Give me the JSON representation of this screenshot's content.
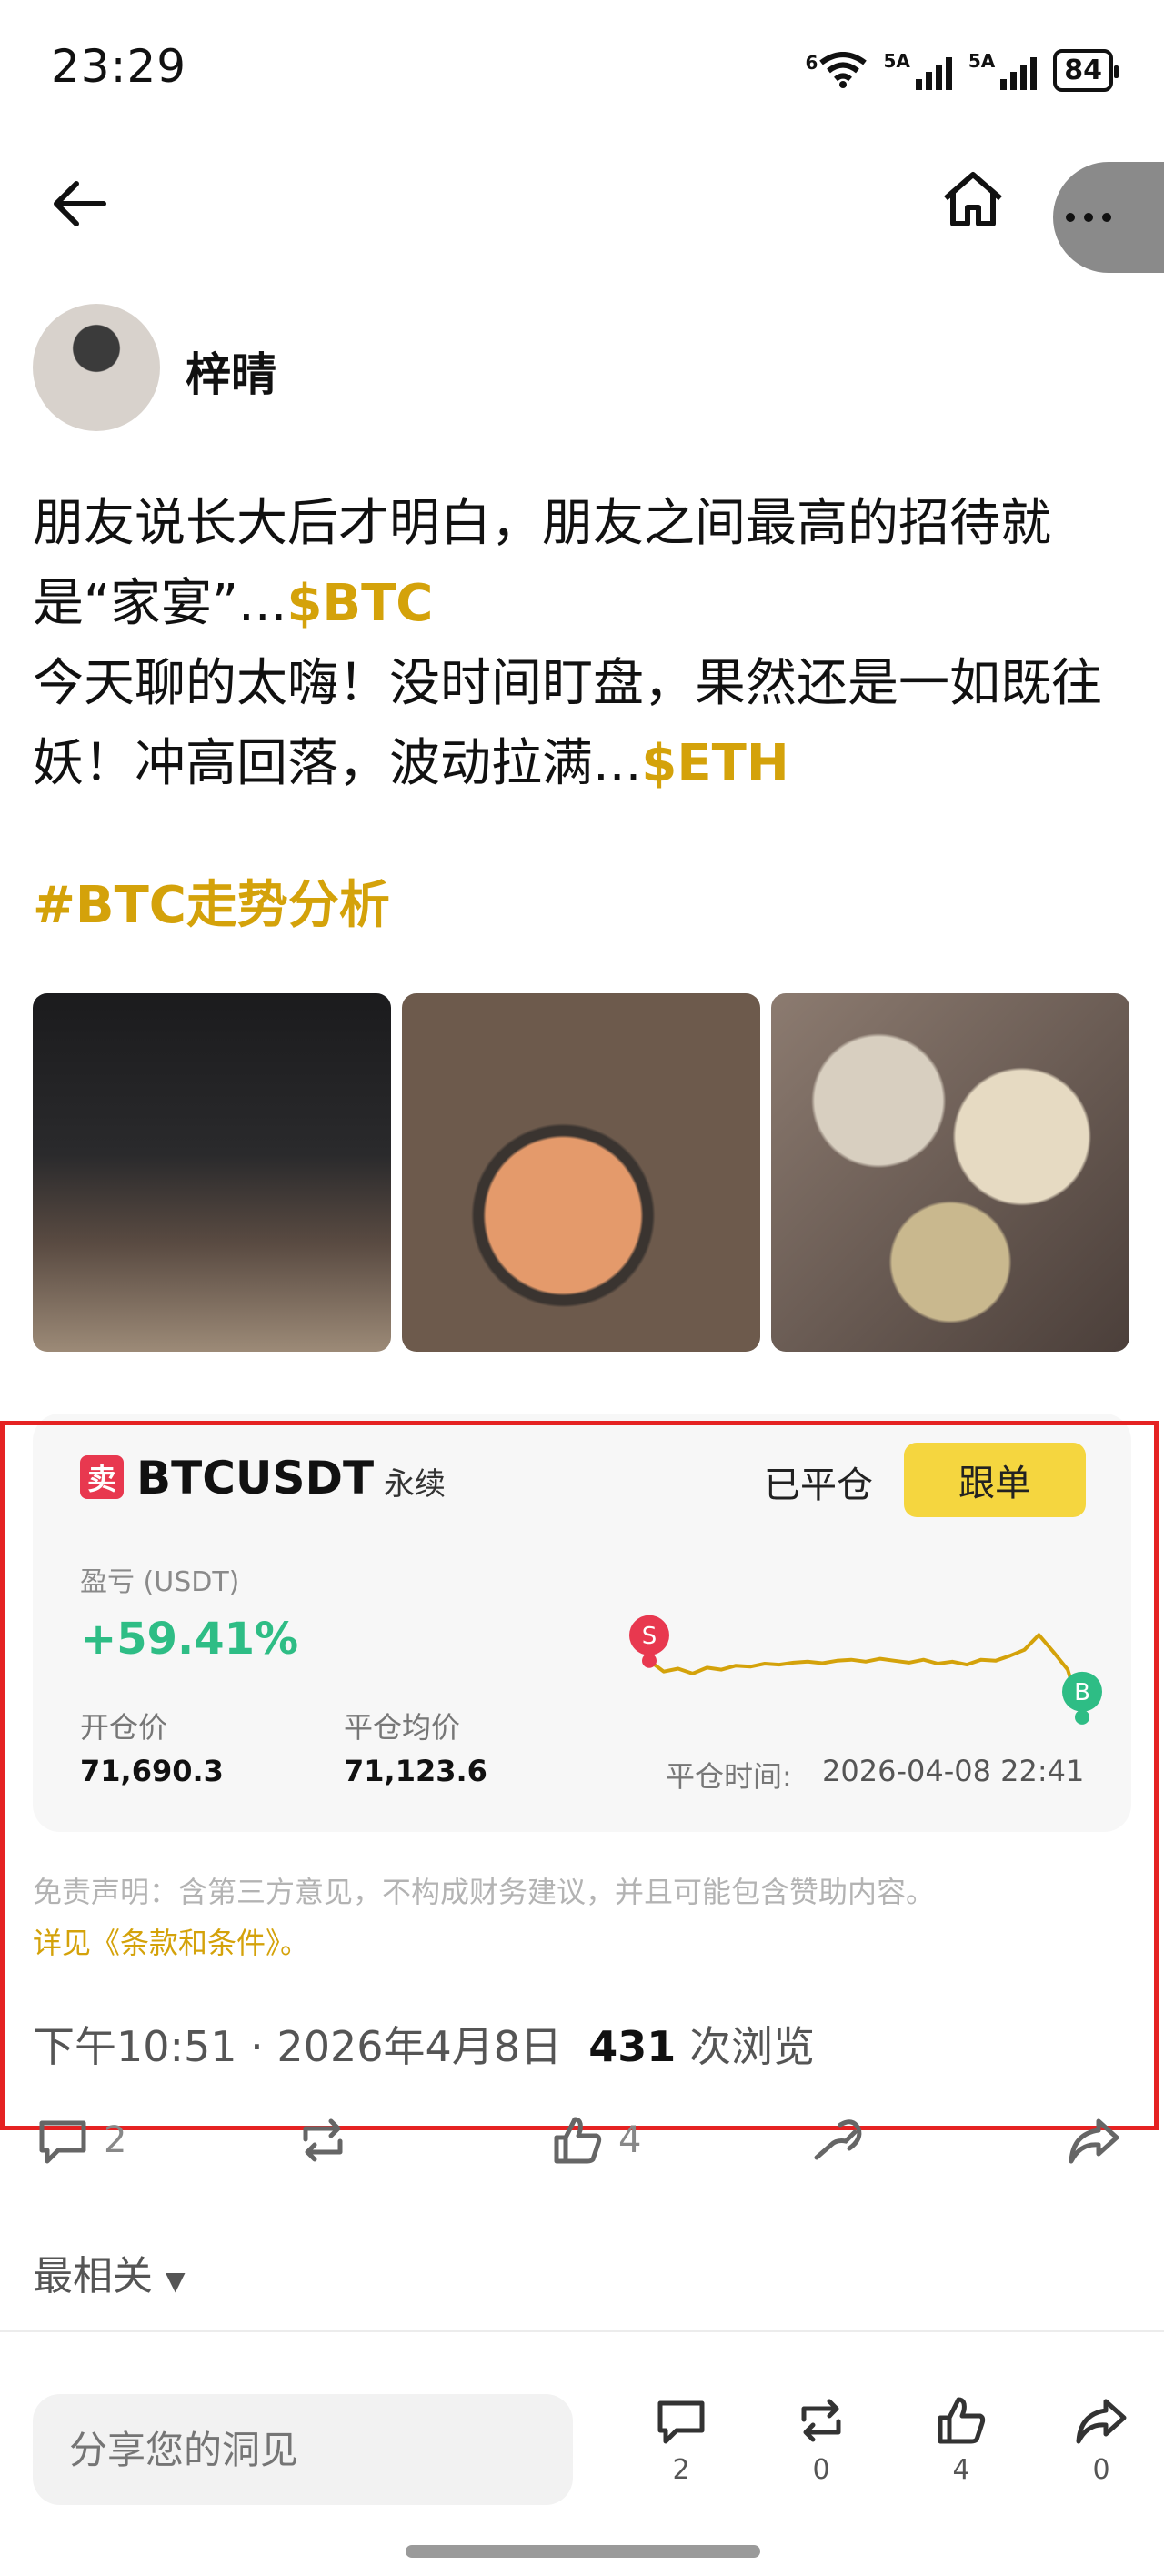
{
  "status_bar": {
    "time": "23:29",
    "wifi_label": "6",
    "sim1_label": "5A",
    "sim2_label": "5A",
    "battery": "84"
  },
  "nav": {
    "back_icon": "arrow-left-icon",
    "home_icon": "home-icon",
    "more_icon": "more-dots-icon"
  },
  "author": {
    "name": "梓晴"
  },
  "post": {
    "line1": "朋友说长大后才明白，朋友之间最高的招待就是“家宴”...",
    "ticker1": "$BTC",
    "line2": "今天聊的太嗨！没时间盯盘，果然还是一如既往妖！冲高回落，波动拉满...",
    "ticker2": "$ETH",
    "hashtag": "#BTC走势分析"
  },
  "trade": {
    "side_badge": "卖",
    "pair": "BTCUSDT",
    "contract_type": "永续",
    "status": "已平仓",
    "follow_label": "跟单",
    "pnl_label": "盈亏 (USDT)",
    "pnl_value": "+59.41%",
    "open_label": "开仓价",
    "open_value": "71,690.3",
    "close_label": "平仓均价",
    "close_value": "71,123.6",
    "close_time_label": "平仓时间:",
    "close_time_value": "2026-04-08 22:41",
    "sell_marker": "S",
    "buy_marker": "B",
    "colors": {
      "sell": "#e8384f",
      "buy": "#2ebd85",
      "line": "#d4a20a"
    }
  },
  "chart_data": {
    "type": "line",
    "x": [
      0,
      1,
      2,
      3,
      4,
      5,
      6,
      7,
      8,
      9,
      10,
      11,
      12,
      13,
      14,
      15,
      16,
      17,
      18,
      19,
      20,
      21,
      22,
      23,
      24,
      25,
      26,
      27,
      28,
      29,
      30
    ],
    "values": [
      71690,
      71580,
      71610,
      71560,
      71620,
      71600,
      71640,
      71630,
      71660,
      71650,
      71670,
      71680,
      71665,
      71690,
      71700,
      71680,
      71710,
      71690,
      71670,
      71700,
      71660,
      71680,
      71650,
      71700,
      71690,
      71740,
      71800,
      71950,
      71780,
      71600,
      71120
    ],
    "series": [
      {
        "values": [
          71690,
          71580,
          71610,
          71560,
          71620,
          71600,
          71640,
          71630,
          71660,
          71650,
          71670,
          71680,
          71665,
          71690,
          71700,
          71680,
          71710,
          71690,
          71670,
          71700,
          71660,
          71680,
          71650,
          71700,
          71690,
          71740,
          71800,
          71950,
          71780,
          71600,
          71120
        ]
      }
    ],
    "markers": [
      {
        "label": "S",
        "x": 0
      },
      {
        "label": "B",
        "x": 30
      }
    ],
    "ylim": [
      71100,
      72000
    ],
    "grid": false
  },
  "disclaimer": {
    "text": "免责声明：含第三方意见，不构成财务建议，并且可能包含赞助内容。",
    "link": "详见《条款和条件》。"
  },
  "meta": {
    "time": "下午10:51 · 2026年4月8日",
    "views": "431",
    "views_suffix": "次浏览"
  },
  "actions": {
    "comment_count": "2",
    "like_count": "4"
  },
  "sort": {
    "label": "最相关"
  },
  "bottom_bar": {
    "placeholder": "分享您的洞见",
    "comment_count": "2",
    "repost_count": "0",
    "like_count": "4",
    "share_count": "0"
  }
}
